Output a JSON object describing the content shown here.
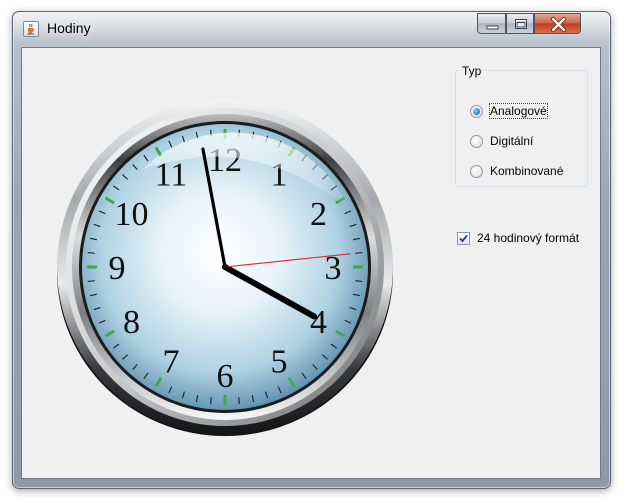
{
  "window": {
    "title": "Hodiny",
    "icon": "java-cup-icon",
    "controls": [
      "minimize-icon",
      "maximize-icon",
      "close-icon"
    ]
  },
  "clock": {
    "numerals": [
      "12",
      "1",
      "2",
      "3",
      "4",
      "5",
      "6",
      "7",
      "8",
      "9",
      "10",
      "11"
    ],
    "time": {
      "hours": 3,
      "minutes": 58,
      "seconds": 14
    },
    "colors": {
      "hour_hand": "#000000",
      "minute_hand": "#000000",
      "second_hand": "#e8252b",
      "hour_ticks": "#3fa64a"
    }
  },
  "type_group": {
    "title": "Typ",
    "options": [
      {
        "label": "Analogové",
        "selected": true
      },
      {
        "label": "Digitální",
        "selected": false
      },
      {
        "label": "Kombinované",
        "selected": false
      }
    ]
  },
  "format_checkbox": {
    "label": "24 hodinový formát",
    "checked": true
  }
}
